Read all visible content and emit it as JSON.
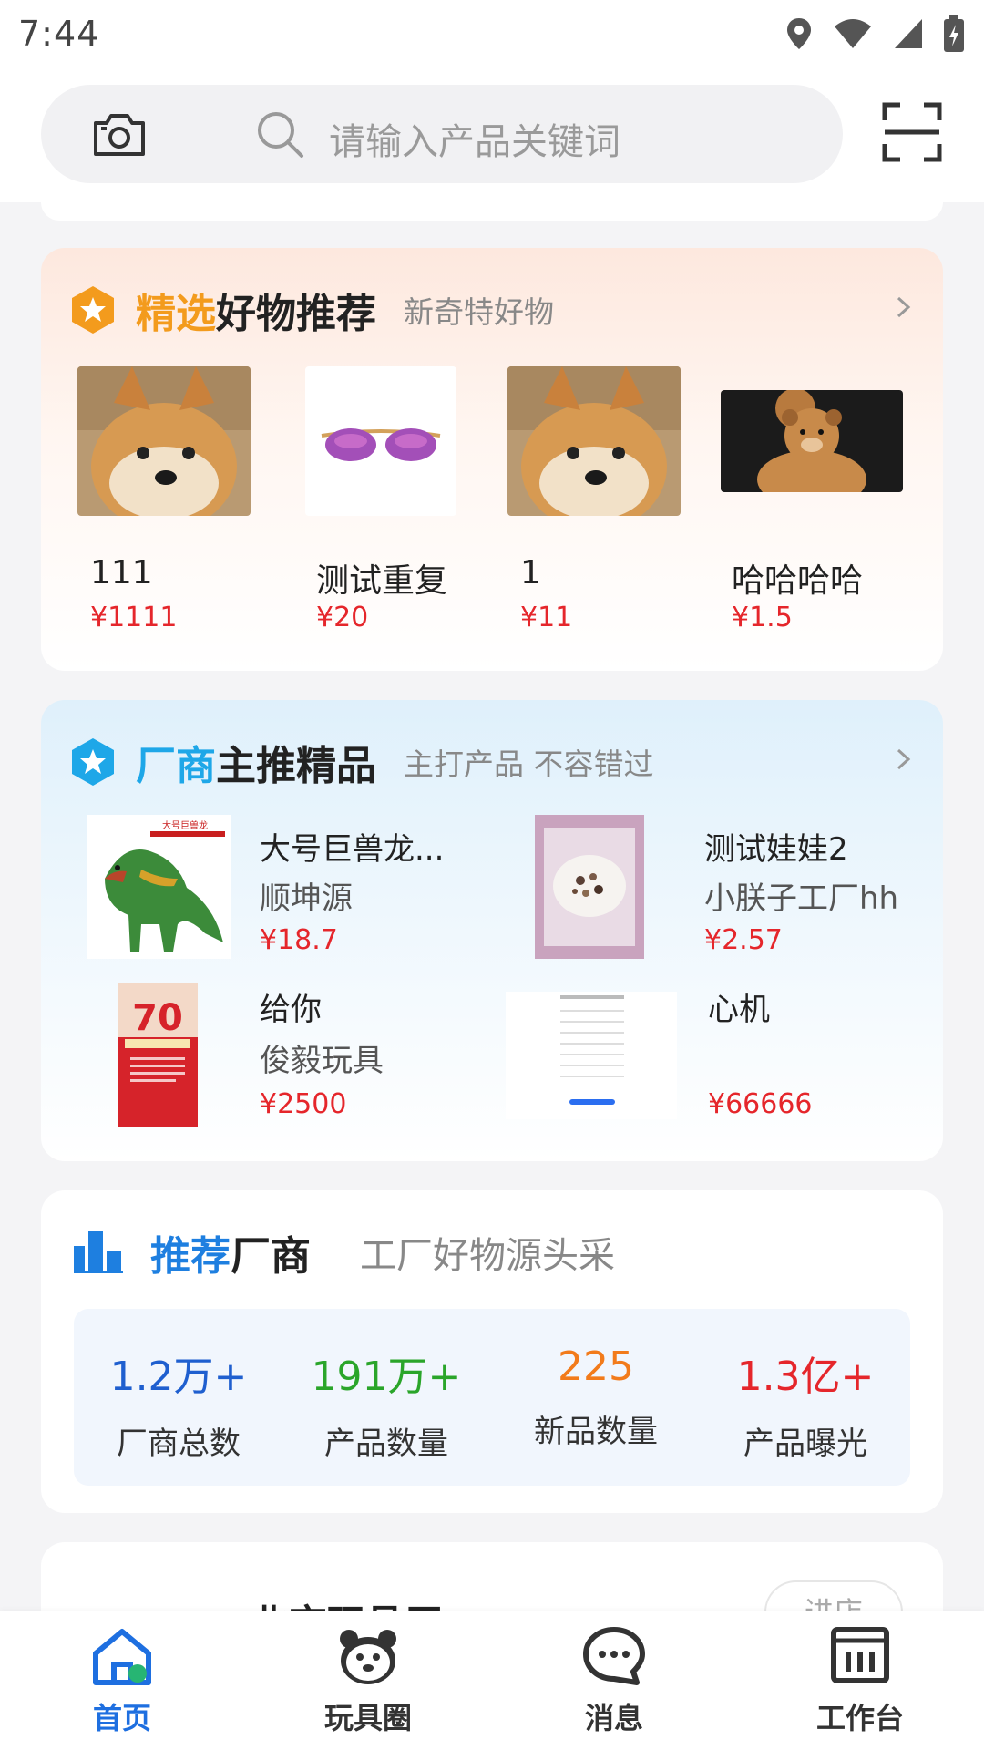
{
  "status_bar": {
    "time": "7:44"
  },
  "search": {
    "placeholder": "请输入产品关键词"
  },
  "featured": {
    "title_accent": "精选",
    "title_main": "好物推荐",
    "subtitle": "新奇特好物",
    "accent_color": "#f39b1d",
    "items": [
      {
        "name": "111",
        "price": "¥1111",
        "image": "shiba-dog-photo"
      },
      {
        "name": "测试重复",
        "price": "¥20",
        "image": "purple-sunglasses-photo"
      },
      {
        "name": "1",
        "price": "¥11",
        "image": "shiba-dog-photo"
      },
      {
        "name": "哈哈哈哈",
        "price": "¥1.5",
        "image": "teddy-bears-photo"
      }
    ]
  },
  "vendor": {
    "title_accent": "厂商",
    "title_main": "主推精品",
    "subtitle": "主打产品 不容错过",
    "accent_color": "#1ea7e8",
    "items": [
      {
        "name": "大号巨兽龙...",
        "shop": "顺坤源",
        "price": "¥18.7",
        "image": "toy-dinosaur-photo",
        "image_caption": "大号巨兽龙"
      },
      {
        "name": "测试娃娃2",
        "shop": "小朕子工厂hh",
        "price": "¥2.57",
        "image": "cereal-bowl-photo"
      },
      {
        "name": "给你",
        "shop": "俊毅玩具",
        "price": "¥2500",
        "image": "celebration-poster"
      },
      {
        "name": "心机",
        "shop": "",
        "price": "¥66666",
        "image": "app-screenshot"
      }
    ]
  },
  "recommend": {
    "title_accent": "推荐",
    "title_main": "厂商",
    "subtitle": "工厂好物源头采",
    "accent_color": "#1e7fe0",
    "stats": [
      {
        "value": "1.2万+",
        "label": "厂商总数",
        "color": "#1f5fcf"
      },
      {
        "value": "191万+",
        "label": "产品数量",
        "color": "#2aa52a"
      },
      {
        "value": "225",
        "label": "新品数量",
        "color": "#f27b1b"
      },
      {
        "value": "1.3亿+",
        "label": "产品曝光",
        "color": "#e5262b"
      }
    ]
  },
  "next_card": {
    "title": "北京玩具厂",
    "button": "进店"
  },
  "bottom_nav": {
    "active_color": "#1e6fe0",
    "inactive_color": "#333333",
    "items": [
      {
        "label": "首页",
        "icon": "home-icon",
        "active": true
      },
      {
        "label": "玩具圈",
        "icon": "bear-icon",
        "active": false
      },
      {
        "label": "消息",
        "icon": "chat-icon",
        "active": false
      },
      {
        "label": "工作台",
        "icon": "dashboard-icon",
        "active": false
      }
    ]
  }
}
